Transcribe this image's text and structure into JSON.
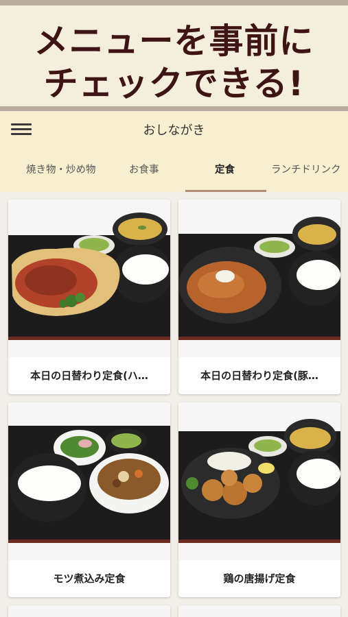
{
  "banner": {
    "line1": "メニューを事前に",
    "line2": "チェックできる!"
  },
  "header": {
    "title": "おしながき"
  },
  "tabs": [
    {
      "label": "焼き物・炒め物"
    },
    {
      "label": "お食事"
    },
    {
      "label": "定食"
    },
    {
      "label": "ランチドリンク"
    }
  ],
  "active_tab": "定食",
  "menu_items": [
    {
      "name": "本日の日替わり定食(ハ…"
    },
    {
      "name": "本日の日替わり定食(豚…"
    },
    {
      "name": "モツ煮込み定食"
    },
    {
      "name": "鶏の唐揚げ定食"
    }
  ],
  "colors": {
    "banner_bg": "#f4eedd",
    "banner_text": "#3e1414",
    "header_bg": "#f7efcf",
    "tab_underline": "#b28c74"
  }
}
